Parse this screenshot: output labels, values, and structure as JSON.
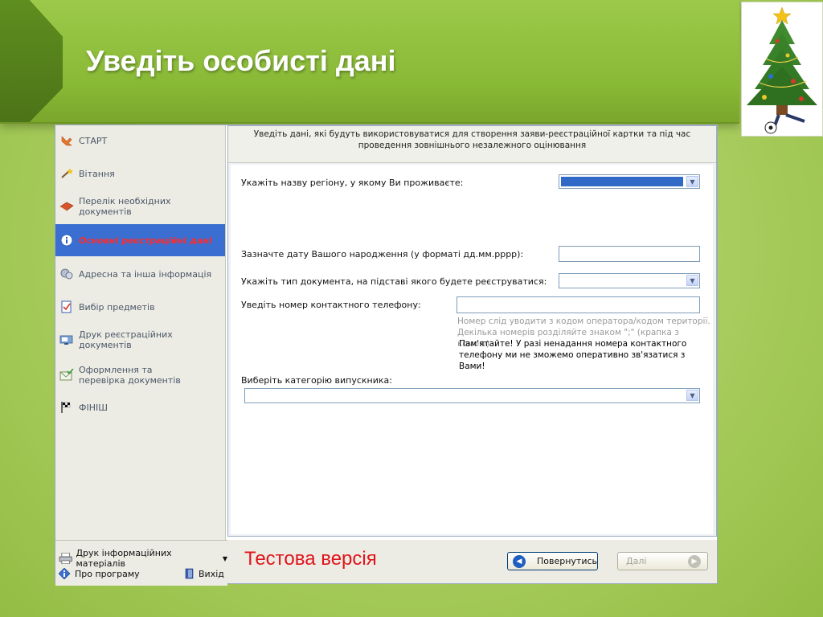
{
  "slide": {
    "title": "Уведіть особисті дані"
  },
  "sidebar": {
    "items": [
      {
        "label": "СТАРТ",
        "icon": "hand-pointer-icon"
      },
      {
        "label": "Вітання",
        "icon": "magic-wand-icon"
      },
      {
        "label": "Перелік необхідних документів",
        "icon": "book-icon"
      },
      {
        "label": "Основні реєстраційні дані",
        "icon": "info-icon",
        "active": true
      },
      {
        "label": "Адресна та інша інформація",
        "icon": "address-icon"
      },
      {
        "label": "Вибір предметів",
        "icon": "checklist-icon"
      },
      {
        "label": "Друк реєстраційних документів",
        "icon": "monitor-icon"
      },
      {
        "label": "Оформлення та перевірка документів",
        "icon": "envelope-check-icon"
      },
      {
        "label": "ФІНІШ",
        "icon": "checkered-flag-icon"
      }
    ],
    "bottom": {
      "print_info": "Друк інформаційних матеріалів",
      "about": "Про програму",
      "exit": "Вихід"
    }
  },
  "panel": {
    "header": "Уведіть дані, які будуть використовуватися для створення заяви-реєстраційної картки та під час проведення зовнішнього незалежного оцінювання"
  },
  "form": {
    "region_label": "Укажіть назву регіону, у якому Ви проживаєте:",
    "birthdate_label": "Зазначте дату Вашого народження (у форматі дд.мм.рррр):",
    "birthdate_value": "",
    "doc_type_label": "Укажіть тип документа, на підставі якого будете реєструватися:",
    "phone_label": "Уведіть номер контактного телефону:",
    "phone_value": "",
    "phone_hint_1": "Номер слід уводити з кодом оператора/кодом території.",
    "phone_hint_2": "Декілька номерів розділяйте знаком \";\" (крапка з комою).",
    "phone_warning_1": "Пам'ятайте! У разі ненадання номера контактного",
    "phone_warning_2": "телефону ми не зможемо оперативно зв'язатися з Вами!",
    "graduate_category_label": "Виберіть категорію випускника:"
  },
  "footer": {
    "test_version": "Тестова версія",
    "back_button": "Повернутись",
    "next_button": "Далі"
  },
  "colors": {
    "active_item_bg": "#3a6fd1",
    "active_item_text": "#ff2a2a",
    "test_version": "#e0141c",
    "header_green": "#88b935"
  }
}
